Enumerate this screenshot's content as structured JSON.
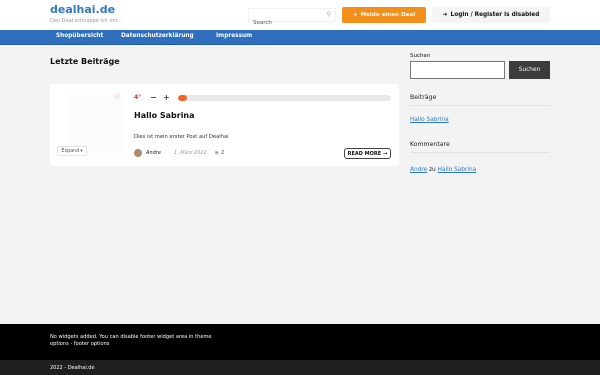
{
  "site": {
    "logo": "dealhai.de",
    "tagline": "Den Deal schnappe ich mir..."
  },
  "header": {
    "search_placeholder": "Search",
    "deal_button": "Melde einen Deal",
    "login_button": "Login / Register is disabled"
  },
  "nav": {
    "items": [
      "Shopübersicht",
      "Datenschutzerklärung",
      "Impressum"
    ]
  },
  "main": {
    "title": "Letzte Beiträge",
    "post": {
      "expand_label": "Expand",
      "temperature": "4°",
      "temperature_fill_fraction": 0.04,
      "title": "Hallo Sabrina",
      "excerpt": "Dies ist mein erster Post auf Dealhai",
      "author": "Andre",
      "date": "1. März 2022",
      "comments": "2",
      "read_more": "READ MORE"
    }
  },
  "sidebar": {
    "search_label": "Suchen",
    "search_button": "Suchen",
    "posts_title": "Beiträge",
    "post_link": "Hallo Sabrina",
    "comments_title": "Kommentare",
    "comment": {
      "author": "Andre",
      "connector": "zu",
      "post": "Hallo Sabrina"
    }
  },
  "footer": {
    "text": "No widgets added. You can disable footer widget area in theme options - footer options",
    "copyright": "2022 - Dealhai.de"
  },
  "colors": {
    "brand": "#2f78c6",
    "nav": "#2f6dbd",
    "accent": "#f28f1b",
    "hot": "#d4322f"
  }
}
